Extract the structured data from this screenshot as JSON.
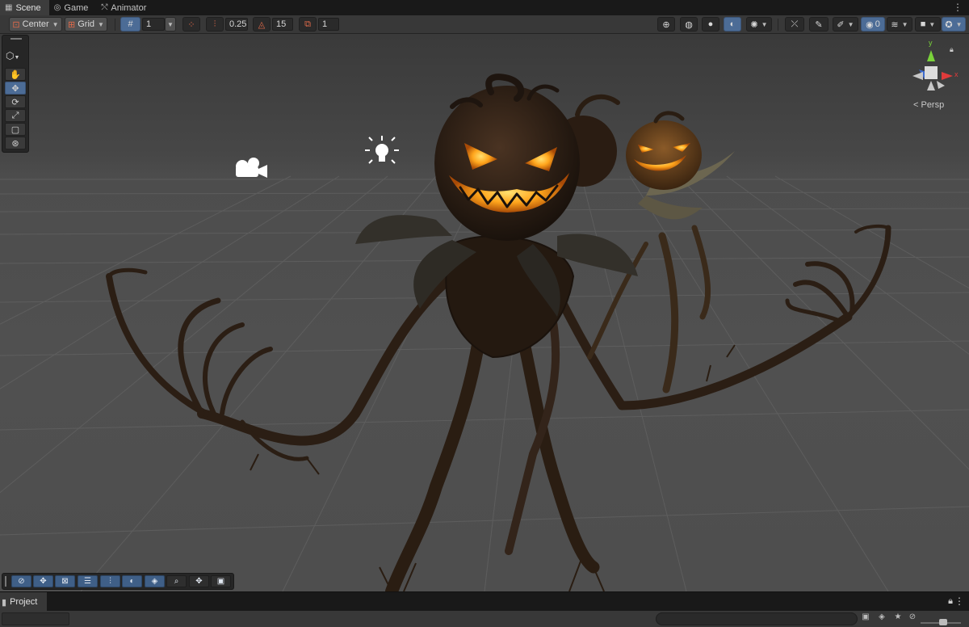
{
  "tabs": [
    {
      "label": "Scene",
      "icon": "grid-icon",
      "active": true
    },
    {
      "label": "Game",
      "icon": "gamepad-icon",
      "active": false
    },
    {
      "label": "Animator",
      "icon": "animator-icon",
      "active": false
    }
  ],
  "toolbar": {
    "pivot_label": "Center",
    "grid_label": "Grid",
    "grid_size_value": "1",
    "snap_increment_value": "0.25",
    "rotate_snap_value": "15",
    "scale_snap_value": "1",
    "visible_layers_count": "0"
  },
  "tools": [
    "view-tool",
    "move-tool",
    "rotate-tool",
    "scale-tool",
    "rect-tool",
    "transform-tool"
  ],
  "active_tool": "move-tool",
  "gizmo": {
    "projection_label": "< Persp",
    "axes": [
      "y",
      "x"
    ]
  },
  "overlay_tools": [
    "orbit",
    "move",
    "transform",
    "align",
    "snap",
    "shading",
    "terrain",
    "zoom",
    "pan",
    "camera"
  ],
  "project_panel": {
    "tab_label": "Project"
  },
  "colors": {
    "accent": "#4c6c96",
    "toolbar_bg": "#383838",
    "tab_bg": "#191919",
    "axis_y": "#7ad23a",
    "axis_x": "#e03b3b",
    "axis_z": "#3b6fe0",
    "pumpkin_glow": "#ffb020"
  }
}
